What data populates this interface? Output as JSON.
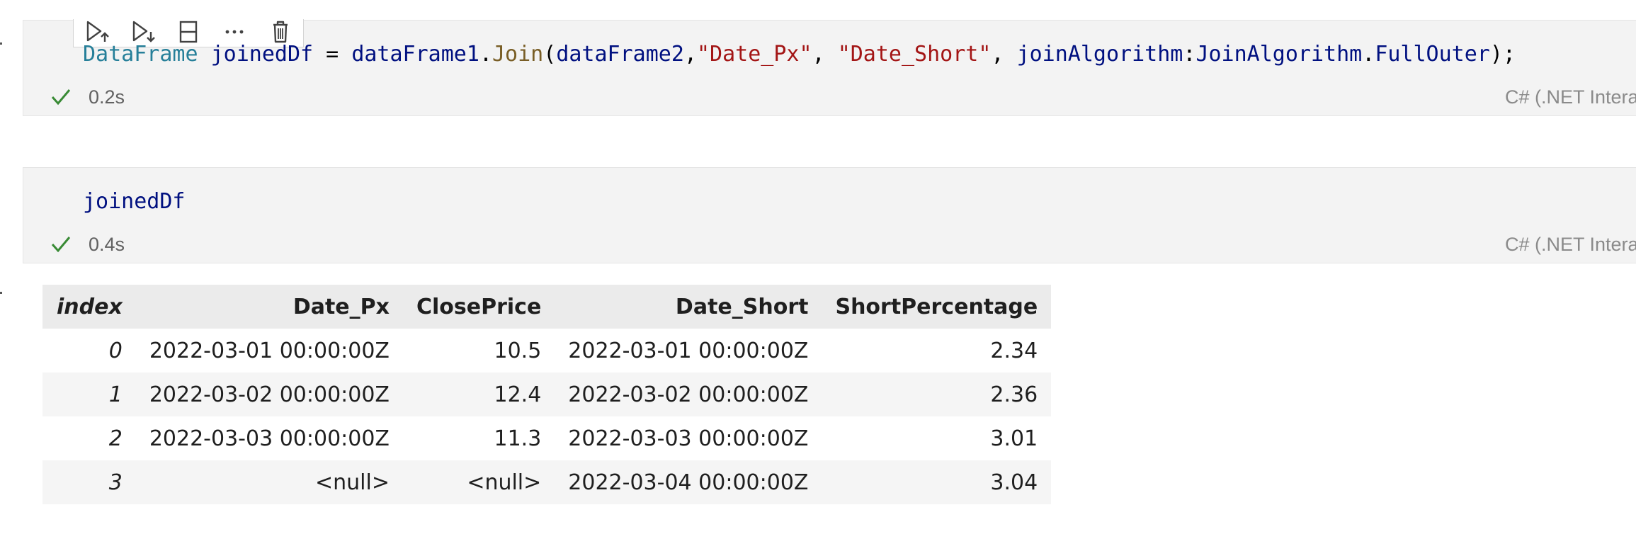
{
  "toolbar": {
    "icons": [
      "run-above-icon",
      "run-below-icon",
      "split-cell-icon",
      "more-icon",
      "delete-icon"
    ]
  },
  "cell1": {
    "code_tokens": [
      {
        "text": "DataFrame",
        "kind": "type"
      },
      {
        "text": " ",
        "kind": "plain"
      },
      {
        "text": "joinedDf",
        "kind": "var"
      },
      {
        "text": " = ",
        "kind": "plain"
      },
      {
        "text": "dataFrame1",
        "kind": "var"
      },
      {
        "text": ".",
        "kind": "plain"
      },
      {
        "text": "Join",
        "kind": "fn"
      },
      {
        "text": "(",
        "kind": "plain"
      },
      {
        "text": "dataFrame2",
        "kind": "var"
      },
      {
        "text": ",",
        "kind": "plain"
      },
      {
        "text": "\"Date_Px\"",
        "kind": "str"
      },
      {
        "text": ", ",
        "kind": "plain"
      },
      {
        "text": "\"Date_Short\"",
        "kind": "str"
      },
      {
        "text": ", ",
        "kind": "plain"
      },
      {
        "text": "joinAlgorithm",
        "kind": "var"
      },
      {
        "text": ":",
        "kind": "plain"
      },
      {
        "text": "JoinAlgorithm",
        "kind": "var"
      },
      {
        "text": ".",
        "kind": "plain"
      },
      {
        "text": "FullOuter",
        "kind": "var"
      },
      {
        "text": ");",
        "kind": "plain"
      }
    ],
    "duration": "0.2s",
    "kernel": "C# (.NET Intera"
  },
  "cell2": {
    "code_tokens": [
      {
        "text": "joinedDf",
        "kind": "var"
      }
    ],
    "duration": "0.4s",
    "kernel": "C# (.NET Intera"
  },
  "colors": {
    "cell_bg": "#f3f3f3",
    "success_check": "#388a34",
    "type": "#267f99",
    "variable": "#001080",
    "function": "#795e26",
    "string": "#a31515"
  },
  "output_table": {
    "columns": [
      "index",
      "Date_Px",
      "ClosePrice",
      "Date_Short",
      "ShortPercentage"
    ],
    "rows": [
      [
        "0",
        "2022-03-01 00:00:00Z",
        "10.5",
        "2022-03-01 00:00:00Z",
        "2.34"
      ],
      [
        "1",
        "2022-03-02 00:00:00Z",
        "12.4",
        "2022-03-02 00:00:00Z",
        "2.36"
      ],
      [
        "2",
        "2022-03-03 00:00:00Z",
        "11.3",
        "2022-03-03 00:00:00Z",
        "3.01"
      ],
      [
        "3",
        "<null>",
        "<null>",
        "2022-03-04 00:00:00Z",
        "3.04"
      ]
    ]
  }
}
